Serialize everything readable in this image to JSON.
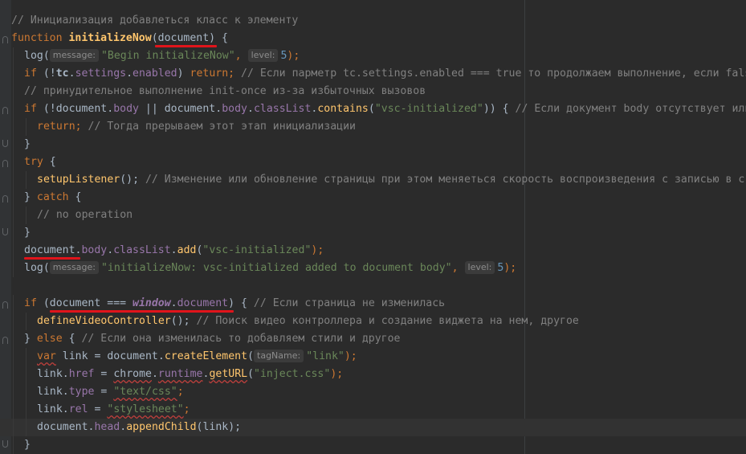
{
  "lines": [
    {
      "indent": 0,
      "fold": "",
      "segments": [
        {
          "t": "// Инициализация добавлеться класс к элементу",
          "c": "cm"
        }
      ]
    },
    {
      "indent": 0,
      "fold": "open",
      "segments": [
        {
          "t": "function ",
          "c": "kw"
        },
        {
          "t": "initializeNow",
          "c": "fn bold"
        },
        {
          "t": "(",
          "c": "plain"
        },
        {
          "t": "document",
          "c": "plain"
        },
        {
          "t": ") {",
          "c": "plain"
        }
      ]
    },
    {
      "indent": 1,
      "fold": "",
      "segments": [
        {
          "t": "log",
          "c": "plain"
        },
        {
          "t": "(",
          "c": "plain"
        },
        {
          "t": "message:",
          "c": "hint"
        },
        {
          "t": "\"Begin initializeNow\"",
          "c": "str"
        },
        {
          "t": ", ",
          "c": "kw"
        },
        {
          "t": "level:",
          "c": "hint"
        },
        {
          "t": "5",
          "c": "num"
        },
        {
          "t": ");",
          "c": "kw"
        }
      ]
    },
    {
      "indent": 1,
      "fold": "",
      "segments": [
        {
          "t": "if ",
          "c": "kw"
        },
        {
          "t": "(!",
          "c": "plain"
        },
        {
          "t": "tc",
          "c": "plain bold"
        },
        {
          "t": ".",
          "c": "plain"
        },
        {
          "t": "settings",
          "c": "prop"
        },
        {
          "t": ".",
          "c": "plain"
        },
        {
          "t": "enabled",
          "c": "prop"
        },
        {
          "t": ") ",
          "c": "plain"
        },
        {
          "t": "return",
          "c": "kw"
        },
        {
          "t": "; ",
          "c": "kw"
        },
        {
          "t": "// Если парметр tc.settings.enabled === true то продолжаем выполнение, если false",
          "c": "cm"
        }
      ]
    },
    {
      "indent": 1,
      "fold": "",
      "segments": [
        {
          "t": "// принудительное выполнение init-once из-за избыточных вызовов",
          "c": "cm"
        }
      ]
    },
    {
      "indent": 1,
      "fold": "open",
      "segments": [
        {
          "t": "if ",
          "c": "kw"
        },
        {
          "t": "(!",
          "c": "plain"
        },
        {
          "t": "document",
          "c": "plain"
        },
        {
          "t": ".",
          "c": "plain"
        },
        {
          "t": "body",
          "c": "prop"
        },
        {
          "t": " || ",
          "c": "plain"
        },
        {
          "t": "document",
          "c": "plain"
        },
        {
          "t": ".",
          "c": "plain"
        },
        {
          "t": "body",
          "c": "prop"
        },
        {
          "t": ".",
          "c": "plain"
        },
        {
          "t": "classList",
          "c": "prop"
        },
        {
          "t": ".",
          "c": "plain"
        },
        {
          "t": "contains",
          "c": "fn"
        },
        {
          "t": "(",
          "c": "plain"
        },
        {
          "t": "\"vsc-initialized\"",
          "c": "str"
        },
        {
          "t": ")) { ",
          "c": "plain"
        },
        {
          "t": "// Если документ body отсутствует или",
          "c": "cm"
        }
      ]
    },
    {
      "indent": 2,
      "fold": "",
      "segments": [
        {
          "t": "return",
          "c": "kw"
        },
        {
          "t": "; ",
          "c": "kw"
        },
        {
          "t": "// Тогда прерываем этот этап инициализации",
          "c": "cm"
        }
      ]
    },
    {
      "indent": 1,
      "fold": "close",
      "segments": [
        {
          "t": "}",
          "c": "plain"
        }
      ]
    },
    {
      "indent": 1,
      "fold": "open",
      "segments": [
        {
          "t": "try ",
          "c": "kw"
        },
        {
          "t": "{",
          "c": "plain"
        }
      ]
    },
    {
      "indent": 2,
      "fold": "",
      "segments": [
        {
          "t": "setupListener",
          "c": "fn"
        },
        {
          "t": "(); ",
          "c": "plain"
        },
        {
          "t": "// Изменение или обновление страницы при этом меняеться скорость воспроизведения с записью в с",
          "c": "cm"
        }
      ]
    },
    {
      "indent": 1,
      "fold": "open",
      "segments": [
        {
          "t": "} ",
          "c": "plain"
        },
        {
          "t": "catch ",
          "c": "kw"
        },
        {
          "t": "{",
          "c": "plain"
        }
      ]
    },
    {
      "indent": 2,
      "fold": "",
      "segments": [
        {
          "t": "// no operation",
          "c": "cm"
        }
      ]
    },
    {
      "indent": 1,
      "fold": "close",
      "segments": [
        {
          "t": "}",
          "c": "plain"
        }
      ]
    },
    {
      "indent": 1,
      "fold": "",
      "segments": [
        {
          "t": "document",
          "c": "plain"
        },
        {
          "t": ".",
          "c": "plain"
        },
        {
          "t": "body",
          "c": "prop"
        },
        {
          "t": ".",
          "c": "plain"
        },
        {
          "t": "classList",
          "c": "prop"
        },
        {
          "t": ".",
          "c": "plain"
        },
        {
          "t": "add",
          "c": "fn"
        },
        {
          "t": "(",
          "c": "plain"
        },
        {
          "t": "\"vsc-initialized\"",
          "c": "str"
        },
        {
          "t": ");",
          "c": "kw"
        }
      ]
    },
    {
      "indent": 1,
      "fold": "",
      "segments": [
        {
          "t": "log",
          "c": "plain"
        },
        {
          "t": "(",
          "c": "plain"
        },
        {
          "t": "message:",
          "c": "hint"
        },
        {
          "t": "\"initializeNow: vsc-initialized added to document body\"",
          "c": "str"
        },
        {
          "t": ", ",
          "c": "kw"
        },
        {
          "t": "level:",
          "c": "hint"
        },
        {
          "t": "5",
          "c": "num"
        },
        {
          "t": ");",
          "c": "kw"
        }
      ]
    },
    {
      "indent": 0,
      "fold": "",
      "segments": []
    },
    {
      "indent": 1,
      "fold": "open",
      "segments": [
        {
          "t": "if ",
          "c": "kw"
        },
        {
          "t": "(",
          "c": "plain"
        },
        {
          "t": "document",
          "c": "plain"
        },
        {
          "t": " === ",
          "c": "plain"
        },
        {
          "t": "window",
          "c": "glob"
        },
        {
          "t": ".",
          "c": "plain"
        },
        {
          "t": "document",
          "c": "prop"
        },
        {
          "t": ") { ",
          "c": "plain"
        },
        {
          "t": "// Если страница не изменилась",
          "c": "cm"
        }
      ]
    },
    {
      "indent": 2,
      "fold": "",
      "segments": [
        {
          "t": "defineVideoController",
          "c": "fn"
        },
        {
          "t": "(); ",
          "c": "plain"
        },
        {
          "t": "// Поиск видео контроллера и создание виджета на нем, другое",
          "c": "cm"
        }
      ]
    },
    {
      "indent": 1,
      "fold": "open",
      "segments": [
        {
          "t": "} ",
          "c": "plain"
        },
        {
          "t": "else ",
          "c": "kw"
        },
        {
          "t": "{ ",
          "c": "plain"
        },
        {
          "t": "// Если она изменилась то добавляем стили и другое",
          "c": "cm"
        }
      ]
    },
    {
      "indent": 2,
      "fold": "",
      "segments": [
        {
          "t": "var",
          "c": "kw wavy"
        },
        {
          "t": " link = ",
          "c": "plain"
        },
        {
          "t": "document",
          "c": "plain"
        },
        {
          "t": ".",
          "c": "plain"
        },
        {
          "t": "createElement",
          "c": "fn"
        },
        {
          "t": "(",
          "c": "plain"
        },
        {
          "t": "tagName:",
          "c": "hint"
        },
        {
          "t": "\"link\"",
          "c": "str"
        },
        {
          "t": ");",
          "c": "kw"
        }
      ]
    },
    {
      "indent": 2,
      "fold": "",
      "segments": [
        {
          "t": "link",
          "c": "plain"
        },
        {
          "t": ".",
          "c": "plain"
        },
        {
          "t": "href",
          "c": "prop"
        },
        {
          "t": " = ",
          "c": "plain"
        },
        {
          "t": "chrome",
          "c": "plain wavy"
        },
        {
          "t": ".",
          "c": "plain"
        },
        {
          "t": "runtime",
          "c": "prop wavy"
        },
        {
          "t": ".",
          "c": "plain"
        },
        {
          "t": "getURL",
          "c": "fn wavy"
        },
        {
          "t": "(",
          "c": "plain"
        },
        {
          "t": "\"inject.css\"",
          "c": "str"
        },
        {
          "t": ");",
          "c": "kw"
        }
      ]
    },
    {
      "indent": 2,
      "fold": "",
      "segments": [
        {
          "t": "link",
          "c": "plain"
        },
        {
          "t": ".",
          "c": "plain"
        },
        {
          "t": "type",
          "c": "prop"
        },
        {
          "t": " = ",
          "c": "plain"
        },
        {
          "t": "\"text/css\"",
          "c": "str wavy"
        },
        {
          "t": ";",
          "c": "kw"
        }
      ]
    },
    {
      "indent": 2,
      "fold": "",
      "segments": [
        {
          "t": "link",
          "c": "plain"
        },
        {
          "t": ".",
          "c": "plain"
        },
        {
          "t": "rel",
          "c": "prop"
        },
        {
          "t": " = ",
          "c": "plain"
        },
        {
          "t": "\"stylesheet\"",
          "c": "str wavy"
        },
        {
          "t": ";",
          "c": "kw"
        }
      ]
    },
    {
      "indent": 2,
      "fold": "",
      "current": true,
      "segments": [
        {
          "t": "document",
          "c": "plain"
        },
        {
          "t": ".",
          "c": "plain"
        },
        {
          "t": "head",
          "c": "prop"
        },
        {
          "t": ".",
          "c": "plain"
        },
        {
          "t": "appendChild",
          "c": "fn"
        },
        {
          "t": "(link);",
          "c": "plain"
        }
      ]
    },
    {
      "indent": 1,
      "fold": "close",
      "segments": [
        {
          "t": "}",
          "c": "plain"
        }
      ]
    }
  ]
}
